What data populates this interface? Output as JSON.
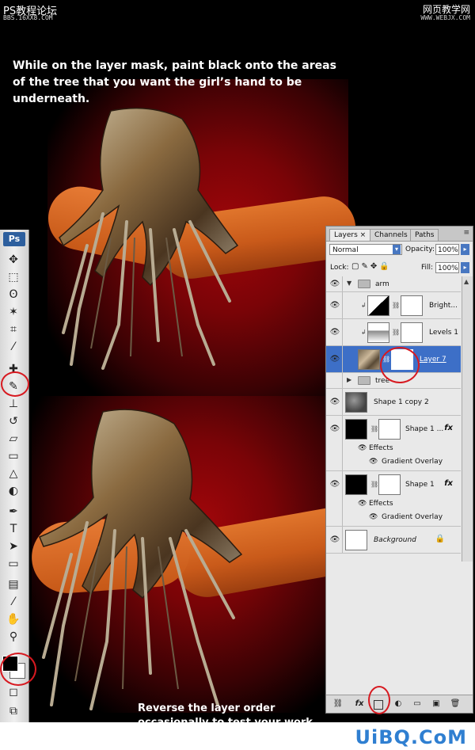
{
  "header": {
    "site_title": "PS教程论坛",
    "site_url": "BBS.16XX8.COM",
    "right_title": "网页教学网",
    "right_url": "WWW.WEBJX.COM"
  },
  "captions": {
    "top": "While on the layer mask, paint black onto the areas of the tree that you want the girl’s hand to be underneath.",
    "bottom": "Reverse the layer order occasionally to test your work."
  },
  "tools": {
    "logo": "Ps",
    "items": [
      {
        "name": "move-tool",
        "icon": "✥"
      },
      {
        "name": "marquee-tool",
        "icon": "⬚"
      },
      {
        "name": "lasso-tool",
        "icon": "ʘ"
      },
      {
        "name": "magic-wand-tool",
        "icon": "✶"
      },
      {
        "name": "crop-tool",
        "icon": "⌗"
      },
      {
        "name": "eyedropper-tool",
        "icon": "⁄"
      },
      {
        "name": "healing-tool",
        "icon": "✚"
      },
      {
        "name": "brush-tool",
        "icon": "✎"
      },
      {
        "name": "clone-stamp-tool",
        "icon": "⊥"
      },
      {
        "name": "history-brush-tool",
        "icon": "↺"
      },
      {
        "name": "eraser-tool",
        "icon": "▱"
      },
      {
        "name": "gradient-tool",
        "icon": "▭"
      },
      {
        "name": "blur-tool",
        "icon": "△"
      },
      {
        "name": "dodge-tool",
        "icon": "◐"
      },
      {
        "name": "pen-tool",
        "icon": "✒"
      },
      {
        "name": "type-tool",
        "icon": "T"
      },
      {
        "name": "path-selection-tool",
        "icon": "➤"
      },
      {
        "name": "shape-tool",
        "icon": "▭"
      },
      {
        "name": "notes-tool",
        "icon": "▤"
      },
      {
        "name": "eyedropper2-tool",
        "icon": "⁄"
      },
      {
        "name": "hand-tool",
        "icon": "✋"
      },
      {
        "name": "zoom-tool",
        "icon": "⚲"
      }
    ],
    "foreground_color": "#000000",
    "background_color": "#ffffff",
    "quickmask_icon": "◻",
    "screen_mode_icon": "⧉"
  },
  "layers_panel": {
    "tabs": [
      "Layers",
      "Channels",
      "Paths"
    ],
    "active_tab": "Layers",
    "blend_mode": "Normal",
    "opacity_label": "Opacity:",
    "opacity_value": "100%",
    "lock_label": "Lock:",
    "fill_label": "Fill:",
    "fill_value": "100%",
    "layers": {
      "arm_group": "arm",
      "brightness": "Bright...",
      "levels": "Levels 1",
      "layer7": "Layer 7",
      "tree_group": "tree",
      "shape_copy2": "Shape 1 copy 2",
      "shape_copy": "Shape 1 ...",
      "effects1": "Effects",
      "gradient1": "Gradient Overlay",
      "shape1": "Shape 1",
      "effects2": "Effects",
      "gradient2": "Gradient Overlay",
      "background": "Background"
    },
    "fx_label": "fx"
  },
  "watermark": "UiBQ.CoM",
  "colors": {
    "selection_blue": "#3d6fc7",
    "annotation_red": "#d71920"
  }
}
